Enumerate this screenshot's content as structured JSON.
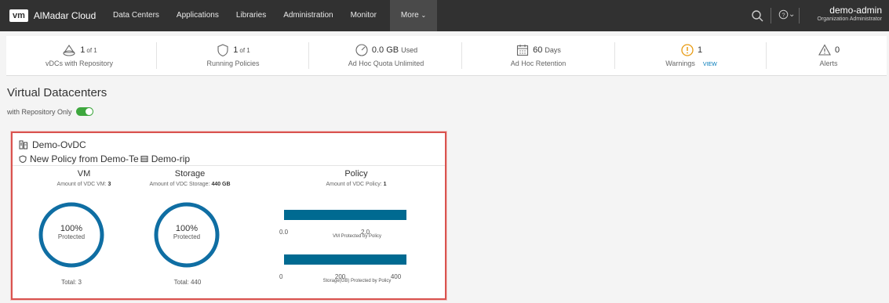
{
  "header": {
    "logo": "vm",
    "app_name": "AlMadar Cloud",
    "nav": [
      "Data Centers",
      "Applications",
      "Libraries",
      "Administration",
      "Monitor"
    ],
    "more_label": "More",
    "help_icon": "help-icon",
    "user_name": "demo-admin",
    "user_role": "Organization Administrator"
  },
  "summary": [
    {
      "icon": "repository-icon",
      "value": "1",
      "suffix": "of 1",
      "label": "vDCs with Repository"
    },
    {
      "icon": "shield-icon",
      "value": "1",
      "suffix": "of 1",
      "label": "Running Policies"
    },
    {
      "icon": "gauge-icon",
      "value": "0.0 GB",
      "suffix": "Used",
      "label": "Ad Hoc Quota Unlimited"
    },
    {
      "icon": "calendar-icon",
      "value": "60",
      "suffix": "Days",
      "label": "Ad Hoc Retention"
    },
    {
      "icon": "warning-circle-icon",
      "value": "1",
      "suffix": "",
      "label": "Warnings",
      "link": "VIEW"
    },
    {
      "icon": "alert-triangle-icon",
      "value": "0",
      "suffix": "",
      "label": "Alerts"
    }
  ],
  "page_title": "Virtual Datacenters",
  "filter": {
    "label": "with Repository Only",
    "enabled": true
  },
  "card": {
    "name": "Demo-OvDC",
    "policy": "New Policy from Demo-Te",
    "repository": "Demo-rip",
    "vm": {
      "heading": "VM",
      "amount_label": "Amount of VDC VM:",
      "amount": "3",
      "percent": "100%",
      "protected_label": "Protected",
      "total_label": "Total: 3",
      "percent_value": 100
    },
    "storage": {
      "heading": "Storage",
      "amount_label": "Amount of VDC Storage:",
      "amount": "440 GB",
      "percent": "100%",
      "protected_label": "Protected",
      "total_label": "Total: 440",
      "percent_value": 100
    },
    "policy_col": {
      "heading": "Policy",
      "amount_label": "Amount of VDC Policy:",
      "amount": "1",
      "vm_chart": {
        "ticks": [
          "0.0",
          "2.0"
        ],
        "caption": "VM Protected by Policy"
      },
      "storage_chart": {
        "ticks": [
          "0",
          "200",
          "400"
        ],
        "caption": "Storage(GB) Protected by Policy"
      }
    }
  },
  "chart_data": [
    {
      "type": "bar",
      "title": "VM Protected by Policy",
      "orientation": "horizontal",
      "values": [
        3
      ],
      "xlim": [
        0,
        3
      ],
      "x_ticks": [
        0.0,
        2.0
      ]
    },
    {
      "type": "bar",
      "title": "Storage(GB) Protected by Policy",
      "orientation": "horizontal",
      "values": [
        440
      ],
      "xlim": [
        0,
        440
      ],
      "x_ticks": [
        0,
        200,
        400
      ]
    }
  ]
}
